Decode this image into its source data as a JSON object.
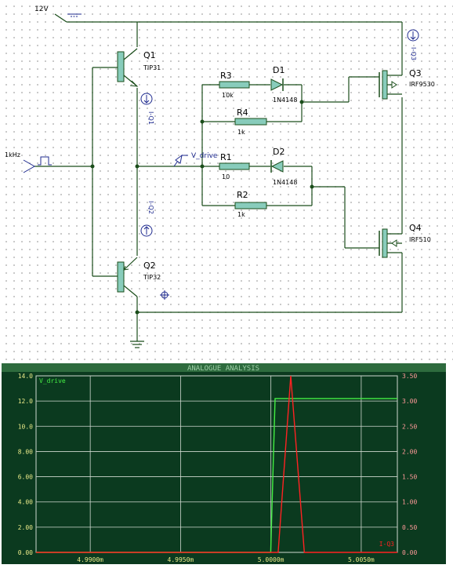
{
  "schematic": {
    "supply_label": "12V",
    "input_label": "1kHz",
    "probe_label": "V_drive",
    "components": {
      "q1": {
        "name": "Q1",
        "part": "TIP31"
      },
      "q2": {
        "name": "Q2",
        "part": "TIP32"
      },
      "q3": {
        "name": "Q3",
        "part": "IRF9530"
      },
      "q4": {
        "name": "Q4",
        "part": "IRF510"
      },
      "r1": {
        "name": "R1",
        "value": "10"
      },
      "r2": {
        "name": "R2",
        "value": "1k"
      },
      "r3": {
        "name": "R3",
        "value": "10k"
      },
      "r4": {
        "name": "R4",
        "value": "1k"
      },
      "d1": {
        "name": "D1",
        "part": "1N4148"
      },
      "d2": {
        "name": "D2",
        "part": "1N4148"
      }
    },
    "current_probes": {
      "iq1": "I-Q1",
      "iq2": "I-Q2",
      "iq3": "I-Q3"
    }
  },
  "graph": {
    "title": "ANALOGUE ANALYSIS",
    "colors": {
      "background": "#0b3a1f",
      "grid": "#cfd8cf",
      "left_axis": "#e8e888",
      "right_axis": "#ff9999",
      "v_drive": "#44ee44",
      "i_q3": "#ff2222",
      "title_bar": "#2e6b3e"
    },
    "left_axis_labels": [
      "14.0",
      "12.0",
      "10.0",
      "8.00",
      "6.00",
      "4.00",
      "2.00",
      "0.00"
    ],
    "right_axis_labels": [
      "3.50",
      "3.00",
      "2.50",
      "2.00",
      "1.50",
      "1.00",
      "0.50",
      "0.00"
    ],
    "x_axis_labels": [
      "4.9900m",
      "4.9950m",
      "5.0000m",
      "5.0050m"
    ]
  },
  "chart_data": {
    "type": "line",
    "title": "ANALOGUE ANALYSIS",
    "xlim": [
      4.987,
      5.007
    ],
    "ylim_left": [
      0,
      14
    ],
    "ylim_right": [
      0,
      3.5
    ],
    "grid": true,
    "series": [
      {
        "name": "V_drive",
        "axis": "left",
        "x": [
          4.987,
          4.99999,
          5.00023,
          5.001,
          5.007
        ],
        "y": [
          0,
          0,
          12.2,
          12.2,
          12.2
        ]
      },
      {
        "name": "I-Q3",
        "axis": "right",
        "x": [
          4.987,
          5.0004,
          5.0011,
          5.00185,
          5.007
        ],
        "y": [
          0,
          0,
          3.5,
          0,
          0
        ]
      }
    ]
  }
}
